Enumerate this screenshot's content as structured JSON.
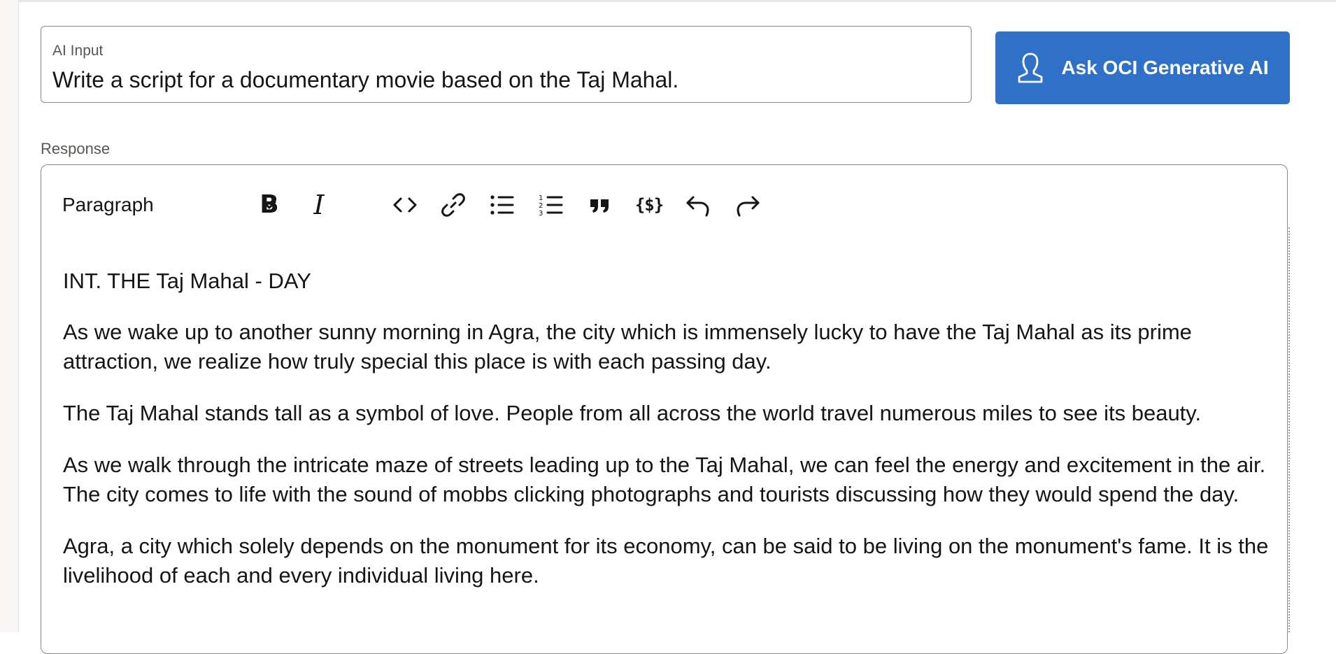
{
  "ai_input": {
    "label": "AI Input",
    "value": "Write a script for a documentary movie based on the Taj Mahal."
  },
  "ask_button": {
    "label": "Ask OCI Generative AI",
    "icon": "user-outline-icon"
  },
  "response": {
    "label": "Response",
    "toolbar": {
      "format_value": "Paragraph",
      "buttons": [
        "bold-icon",
        "italic-icon",
        "code-icon",
        "link-icon",
        "bulleted-list-icon",
        "numbered-list-icon",
        "blockquote-icon",
        "variable-icon",
        "undo-icon",
        "redo-icon"
      ]
    },
    "paragraphs": [
      "INT. THE Taj Mahal - DAY",
      "As we wake up to another sunny morning in Agra, the city which is immensely lucky to have the Taj Mahal as its prime attraction, we realize how truly special this place is with each passing day.",
      "The Taj Mahal stands tall as a symbol of love. People from all across the world travel numerous miles to see its beauty.",
      "As we walk through the intricate maze of streets leading up to the Taj Mahal, we can feel the energy and excitement in the air. The city comes to life with the sound of mobbs clicking photographs and tourists discussing how they would spend the day.",
      "Agra, a city which solely depends on the monument for its economy, can be said to be living on the monument's fame. It is the livelihood of each and every individual living here."
    ]
  },
  "colors": {
    "button_bg": "#2f70c9",
    "border": "#8b8884",
    "label_text": "#5b5652",
    "body_text": "#161513"
  }
}
